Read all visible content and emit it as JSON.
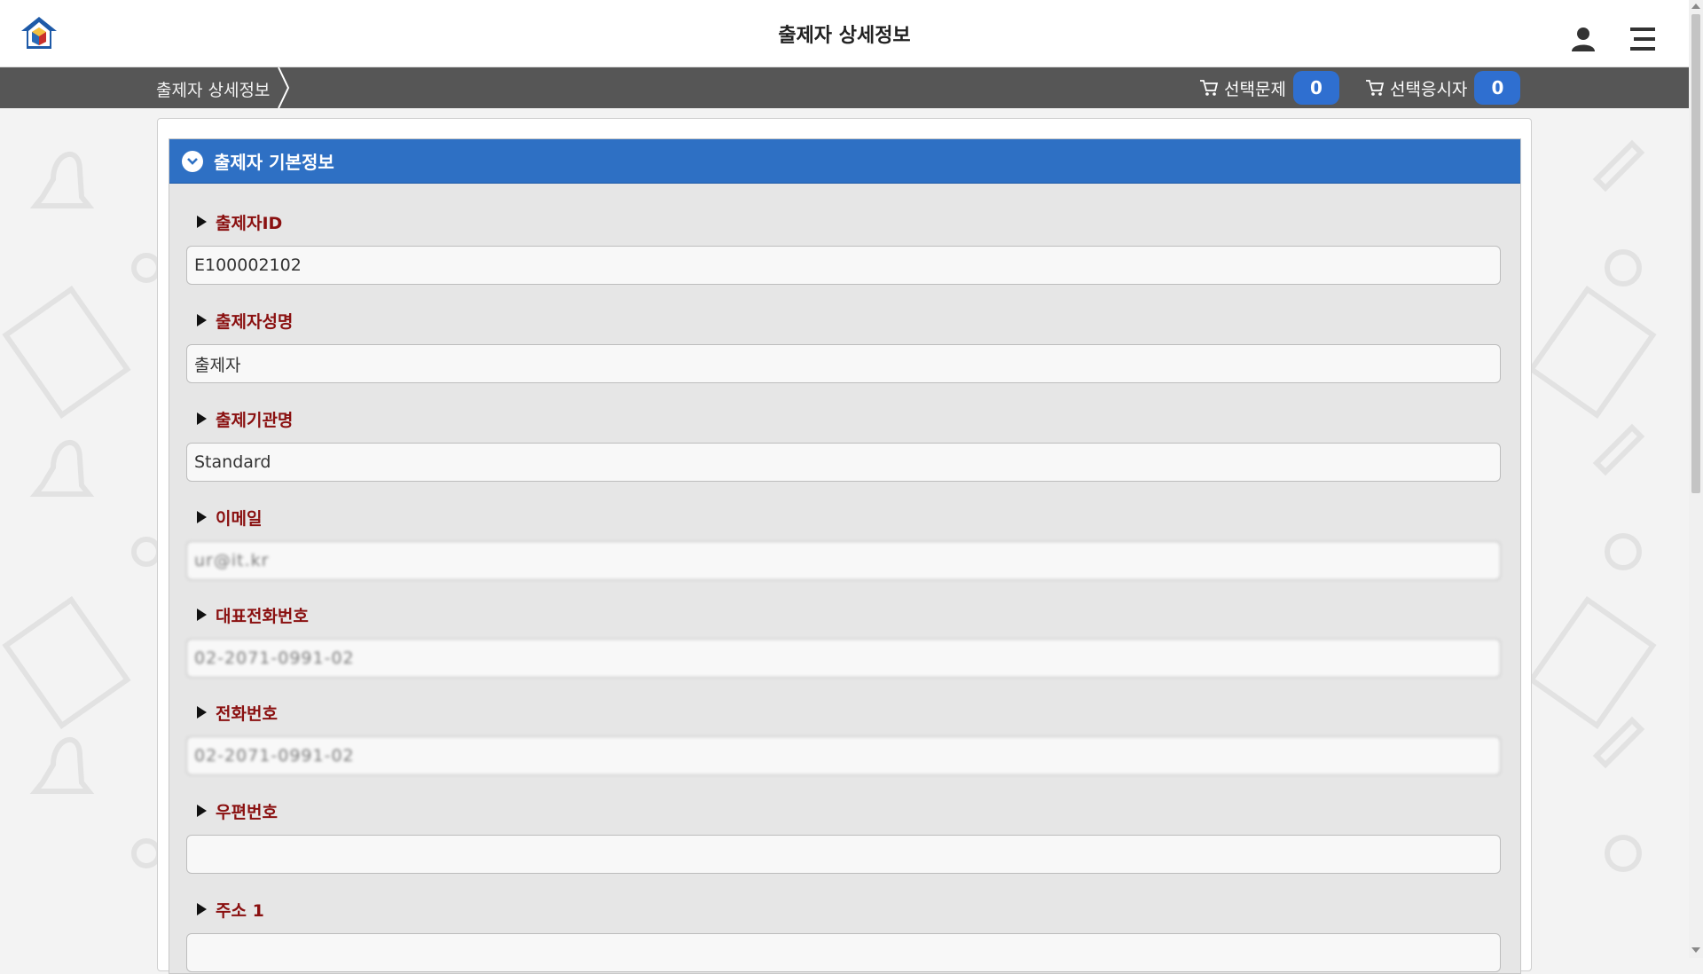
{
  "header": {
    "title": "출제자 상세정보"
  },
  "subbar": {
    "breadcrumb": "출제자 상세정보",
    "cart_problems_label": "선택문제",
    "cart_problems_count": "0",
    "cart_examinees_label": "선택응시자",
    "cart_examinees_count": "0"
  },
  "panel": {
    "title": "출제자 기본정보",
    "fields": [
      {
        "label": "출제자ID",
        "value": "E100002102"
      },
      {
        "label": "출제자성명",
        "value": "출제자"
      },
      {
        "label": "출제기관명",
        "value": "Standard"
      },
      {
        "label": "이메일",
        "value": "ur@it.kr"
      },
      {
        "label": "대표전화번호",
        "value": "02-2071-0991-02"
      },
      {
        "label": "전화번호",
        "value": "02-2071-0991-02"
      },
      {
        "label": "우편번호",
        "value": ""
      },
      {
        "label": "주소 1",
        "value": ""
      }
    ]
  },
  "colors": {
    "accent": "#2e70c4",
    "subbar": "#565656",
    "label": "#8a1010",
    "badge": "#2f6fd0"
  }
}
